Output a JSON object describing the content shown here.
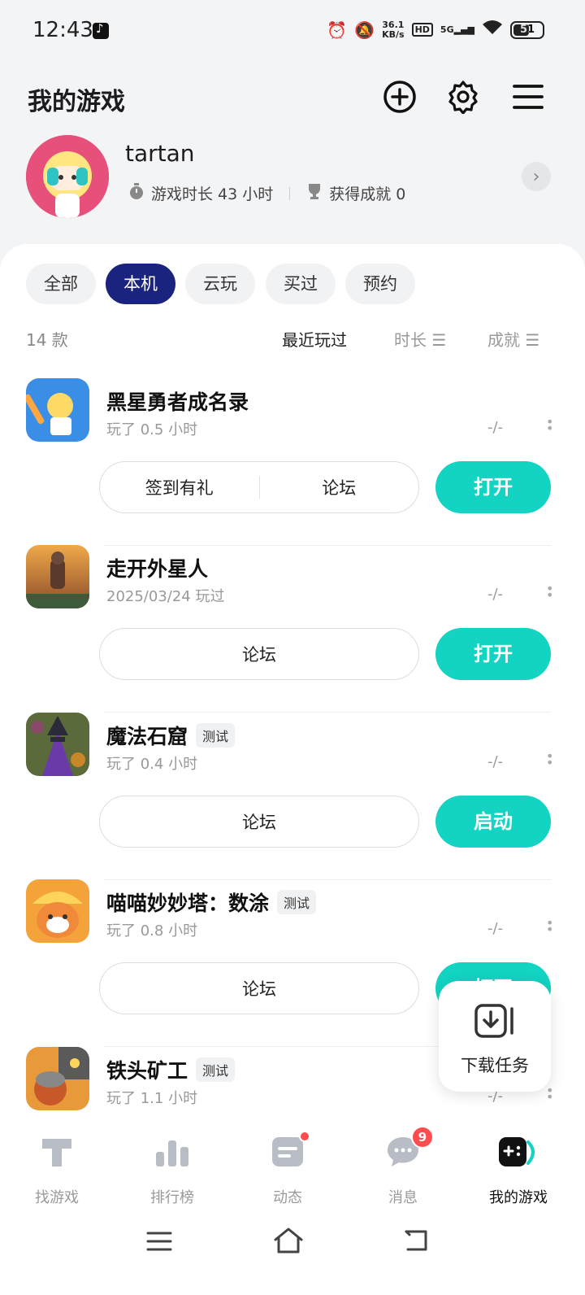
{
  "status_bar": {
    "time": "12:43",
    "net_speed_value": "36.1",
    "net_speed_unit": "KB/s",
    "hd": "HD",
    "signal": "5G",
    "battery": "51"
  },
  "header": {
    "title": "我的游戏"
  },
  "profile": {
    "username": "tartan",
    "play_time": "游戏时长 43 小时",
    "achievements": "获得成就 0"
  },
  "filters": {
    "chips": [
      "全部",
      "本机",
      "云玩",
      "买过",
      "预约"
    ],
    "active": "本机"
  },
  "list": {
    "count": "14 款",
    "sort_recent": "最近玩过",
    "sort_duration": "时长",
    "sort_achievement": "成就"
  },
  "games": [
    {
      "name": "黑星勇者成名录",
      "tag": "",
      "meta": "玩了 0.5 小时",
      "score": "-/-",
      "actions": [
        "签到有礼",
        "论坛"
      ],
      "button": "打开"
    },
    {
      "name": "走开外星人",
      "tag": "",
      "meta": "2025/03/24 玩过",
      "score": "-/-",
      "actions": [
        "论坛"
      ],
      "button": "打开"
    },
    {
      "name": "魔法石窟",
      "tag": "测试",
      "meta": "玩了 0.4 小时",
      "score": "-/-",
      "actions": [
        "论坛"
      ],
      "button": "启动"
    },
    {
      "name": "喵喵妙妙塔：数涂",
      "tag": "测试",
      "meta": "玩了 0.8 小时",
      "score": "-/-",
      "actions": [
        "论坛"
      ],
      "button": "打开"
    },
    {
      "name": "铁头矿工",
      "tag": "测试",
      "meta": "玩了 1.1 小时",
      "score": "-/-",
      "actions": [],
      "button": ""
    }
  ],
  "download_fab": {
    "label": "下载任务"
  },
  "bottom_nav": {
    "items": [
      "找游戏",
      "排行榜",
      "动态",
      "消息",
      "我的游戏"
    ],
    "message_badge": "9"
  },
  "colors": {
    "accent": "#13d3c2",
    "chip_active": "#1a237e",
    "badge": "#ff4d4f"
  }
}
